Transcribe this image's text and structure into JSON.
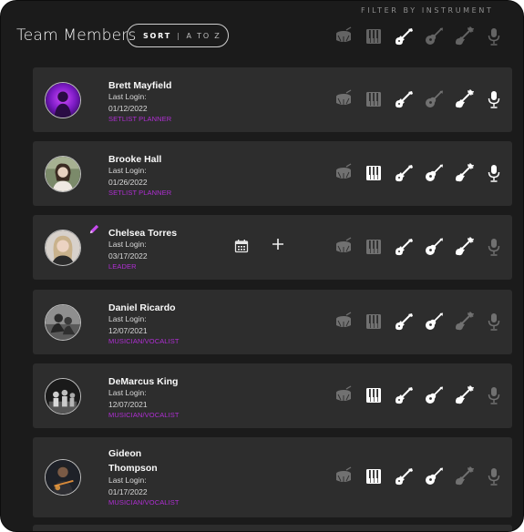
{
  "header": {
    "title": "Team Members",
    "filter_label": "FILTER BY INSTRUMENT",
    "sort_key": "SORT",
    "sort_separator": "|",
    "sort_value": "A TO Z"
  },
  "filters": {
    "drums": false,
    "keys": false,
    "electric_guitar": true,
    "acoustic_guitar": false,
    "bass": false,
    "vocals": false
  },
  "members": [
    {
      "name": "Brett Mayfield",
      "last_login_label": "Last Login:",
      "last_login": "01/12/2022",
      "role": "SETLIST PLANNER",
      "instruments": {
        "drums": false,
        "keys": false,
        "electric_guitar": true,
        "acoustic_guitar": false,
        "bass": true,
        "vocals": true
      }
    },
    {
      "name": "Brooke Hall",
      "last_login_label": "Last Login:",
      "last_login": "01/26/2022",
      "role": "SETLIST PLANNER",
      "instruments": {
        "drums": false,
        "keys": true,
        "electric_guitar": true,
        "acoustic_guitar": true,
        "bass": true,
        "vocals": true
      }
    },
    {
      "name": "Chelsea Torres",
      "last_login_label": "Last Login:",
      "last_login": "03/17/2022",
      "role": "LEADER",
      "instruments": {
        "drums": false,
        "keys": false,
        "electric_guitar": true,
        "acoustic_guitar": true,
        "bass": true,
        "vocals": false
      }
    },
    {
      "name": "Daniel Ricardo",
      "last_login_label": "Last Login:",
      "last_login": "12/07/2021",
      "role": "MUSICIAN/VOCALIST",
      "instruments": {
        "drums": false,
        "keys": false,
        "electric_guitar": true,
        "acoustic_guitar": true,
        "bass": false,
        "vocals": false
      }
    },
    {
      "name": "DeMarcus King",
      "last_login_label": "Last Login:",
      "last_login": "12/07/2021",
      "role": "MUSICIAN/VOCALIST",
      "instruments": {
        "drums": false,
        "keys": true,
        "electric_guitar": true,
        "acoustic_guitar": true,
        "bass": true,
        "vocals": false
      }
    },
    {
      "name_line1": "Gideon",
      "name_line2": "Thompson",
      "last_login_label": "Last Login:",
      "last_login": "01/17/2022",
      "role": "MUSICIAN/VOCALIST",
      "instruments": {
        "drums": false,
        "keys": true,
        "electric_guitar": true,
        "acoustic_guitar": true,
        "bass": false,
        "vocals": false
      }
    }
  ],
  "colors": {
    "background": "#1b1b1b",
    "card": "#2d2d2d",
    "role_accent": "#b02ed4"
  }
}
